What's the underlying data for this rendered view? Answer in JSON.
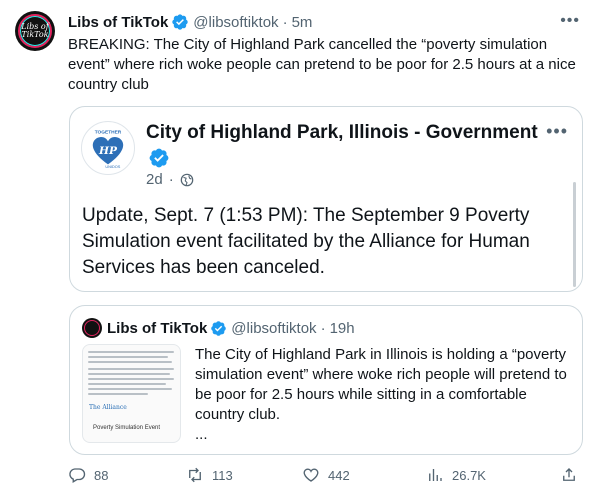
{
  "tweet": {
    "author_name": "Libs of TikTok",
    "author_handle": "@libsoftiktok",
    "separator": "·",
    "time": "5m",
    "avatar_text": "Libs of TikTok",
    "text": "BREAKING: The City of Highland Park cancelled the “poverty simulation event” where rich woke people can pretend to be poor for 2.5 hours at a nice country club"
  },
  "embedded_post": {
    "author_name": "City of Highland Park, Illinois - Government",
    "logo_text_top": "TOGETHER",
    "logo_initials": "HP",
    "logo_text_bottom": "UNIDOS",
    "age": "2d",
    "separator": "·",
    "text": "Update, Sept. 7 (1:53 PM): The September 9 Poverty Simulation event facilitated by the Alliance for Human Services has been canceled."
  },
  "quoted_tweet": {
    "author_name": "Libs of TikTok",
    "author_handle": "@libsoftiktok",
    "separator": "·",
    "time": "19h",
    "thumbnail_title": "Poverty Simulation Event",
    "thumbnail_org": "The Alliance",
    "text": "The City of Highland Park in Illinois is holding a “poverty simulation event” where woke rich people will pretend to be poor for 2.5 hours while sitting in a comfortable country club.",
    "more": "..."
  },
  "actions": {
    "replies": "88",
    "retweets": "113",
    "likes": "442",
    "views": "26.7K"
  },
  "colors": {
    "text": "#0f1419",
    "secondary": "#536471",
    "border": "#cfd9de",
    "verified": "#1d9bf0",
    "hp_blue": "#2d6fb7"
  },
  "icons": {
    "verified": "verified-badge-icon",
    "more": "more-dots-icon",
    "globe": "globe-icon",
    "reply": "reply-icon",
    "retweet": "retweet-icon",
    "like": "heart-icon",
    "views": "views-icon",
    "share": "share-icon"
  }
}
